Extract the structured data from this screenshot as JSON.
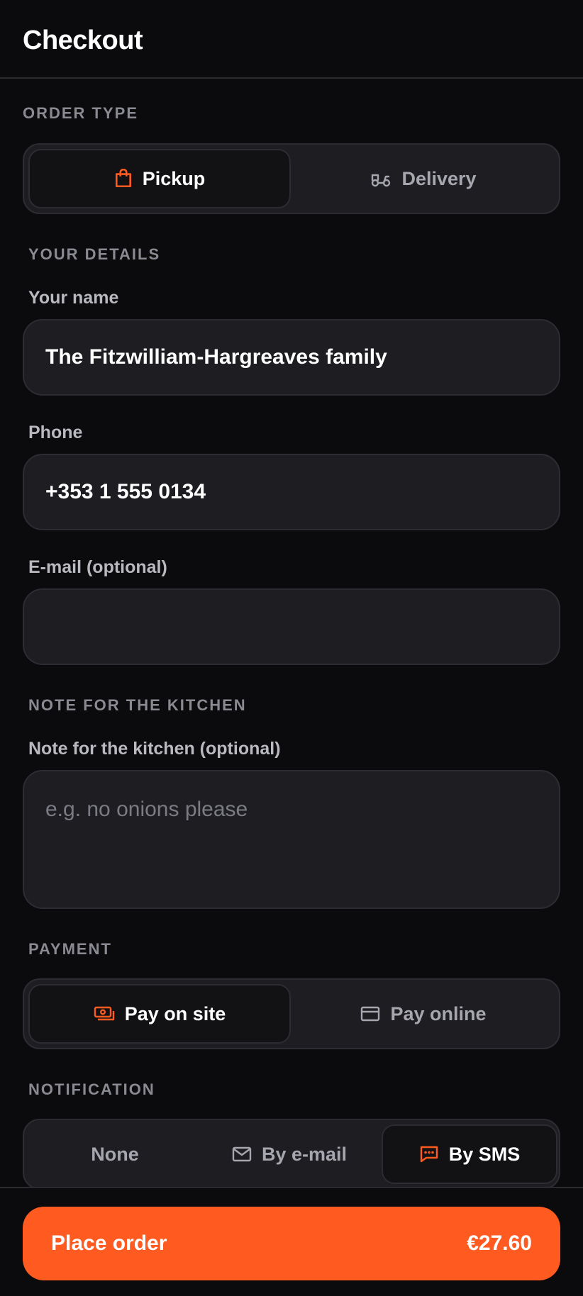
{
  "header": {
    "title": "Checkout"
  },
  "order_type": {
    "section_label": "ORDER TYPE",
    "options": [
      {
        "label": "Pickup",
        "icon": "shopping-bag-icon",
        "active": true
      },
      {
        "label": "Delivery",
        "icon": "scooter-icon",
        "active": false
      }
    ]
  },
  "details": {
    "section_label": "YOUR DETAILS",
    "name": {
      "label": "Your name",
      "value": "The Fitzwilliam-Hargreaves family"
    },
    "phone": {
      "label": "Phone",
      "value": "+353 1 555 0134"
    },
    "email": {
      "label": "E-mail (optional)",
      "value": ""
    }
  },
  "kitchen_note": {
    "section_label": "NOTE FOR THE KITCHEN",
    "label": "Note for the kitchen (optional)",
    "placeholder": "e.g. no onions please",
    "value": ""
  },
  "payment": {
    "section_label": "PAYMENT",
    "options": [
      {
        "label": "Pay on site",
        "icon": "cash-icon",
        "active": true
      },
      {
        "label": "Pay online",
        "icon": "credit-card-icon",
        "active": false
      }
    ]
  },
  "notification": {
    "section_label": "NOTIFICATION",
    "options": [
      {
        "label": "None",
        "active": false
      },
      {
        "label": "By e-mail",
        "icon": "mail-icon",
        "active": false
      },
      {
        "label": "By SMS",
        "icon": "message-icon",
        "active": true
      }
    ]
  },
  "footer": {
    "button_label": "Place order",
    "total": "€27.60"
  },
  "colors": {
    "accent": "#ff5a1f",
    "background": "#0b0b0d",
    "surface": "#1d1d22",
    "muted": "#8a8a93"
  }
}
